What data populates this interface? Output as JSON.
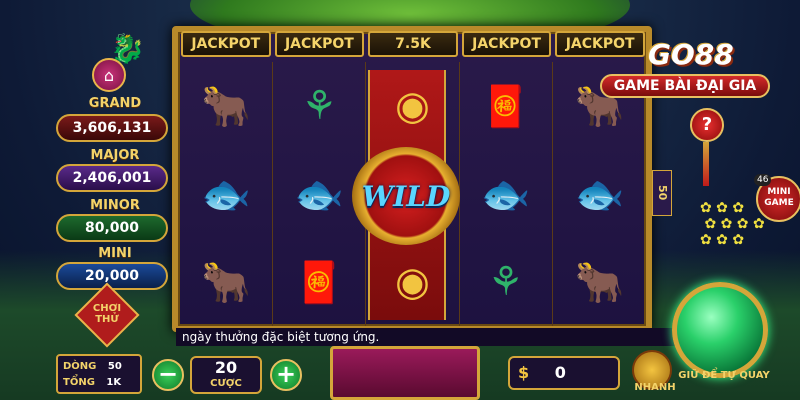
{
  "top_jackpots": [
    "JACKPOT",
    "JACKPOT",
    "7.5K",
    "JACKPOT",
    "JACKPOT"
  ],
  "left_panel": {
    "grand_label": "GRAND",
    "grand_value": "3,606,131",
    "major_label": "MAJOR",
    "major_value": "2,406,001",
    "minor_label": "MINOR",
    "minor_value": "80,000",
    "mini_label": "MINI",
    "mini_value": "20,000",
    "play_trial": "CHƠI THỬ"
  },
  "reels": [
    [
      "ox",
      "jade",
      "coin",
      "envelope",
      "ox"
    ],
    [
      "fish",
      "fish",
      "wild",
      "fish",
      "fish"
    ],
    [
      "ox",
      "envelope",
      "coin",
      "jade",
      "ox"
    ]
  ],
  "wild_label": "WILD",
  "logo": {
    "brand": "GO88",
    "tagline": "GAME BÀI ĐẠI GIA"
  },
  "help_label": "?",
  "lines_side": "50",
  "mini_game": {
    "badge": "46",
    "label": "MINI GAME"
  },
  "ticker": "ngày thưởng đặc biệt tương ứng.",
  "bottom": {
    "lines_label": "DÒNG",
    "lines_value": "50",
    "total_label": "TỔNG",
    "total_value": "1K",
    "minus": "−",
    "plus": "+",
    "bet_value": "20",
    "bet_label": "CƯỢC",
    "win_symbol": "$",
    "win_value": "0",
    "fast_label": "NHANH",
    "auto_label": "GIỮ ĐỂ TỰ QUAY"
  },
  "colors": {
    "gold": "#d4a63a",
    "jackpot_text": "#f5d46a",
    "spin_green": "#2ad06a"
  },
  "icons": {
    "home": "home-icon",
    "ox": "golden-ox-icon",
    "fish": "golden-fish-icon",
    "jade": "jade-ruyi-icon",
    "envelope": "red-envelope-icon",
    "coin": "gold-coin-icon"
  }
}
